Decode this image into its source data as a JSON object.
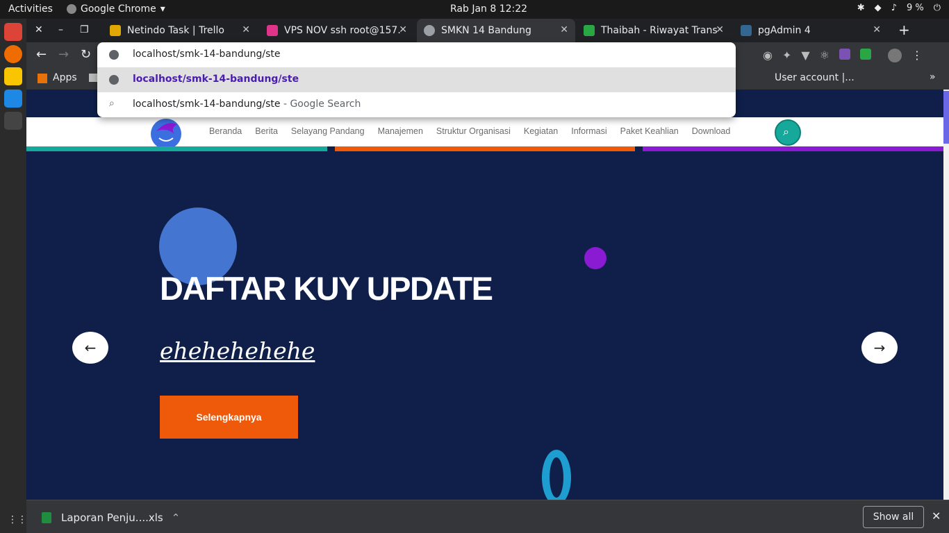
{
  "system": {
    "activities": "Activities",
    "app_name": "Google Chrome",
    "clock": "Rab Jan 8  12:22",
    "battery": "9 %"
  },
  "tabs": [
    {
      "title": "Netindo Task | Trello",
      "favicon_color": "#e0a800"
    },
    {
      "title": "VPS NOV ssh root@157.",
      "favicon_color": "#e0348a"
    },
    {
      "title": "SMKN 14 Bandung",
      "favicon_color": "#9aa0a6",
      "active": true
    },
    {
      "title": "Thaibah - Riwayat Trans",
      "favicon_color": "#2aa745"
    },
    {
      "title": "pgAdmin 4",
      "favicon_color": "#336791"
    }
  ],
  "omnibox": {
    "input_value": "localhost/smk-14-bandung/ste",
    "suggestions": [
      {
        "text": "localhost/smk-14-bandung/ste",
        "kind": "url"
      },
      {
        "text": "localhost/smk-14-bandung/ste",
        "suffix": " - Google Search",
        "kind": "search"
      }
    ]
  },
  "bookmarks": {
    "apps": "Apps",
    "user_account": "User account |..."
  },
  "site": {
    "nav": [
      "Beranda",
      "Berita",
      "Selayang Pandang",
      "Manajemen",
      "Struktur Organisasi",
      "Kegiatan",
      "Informasi",
      "Paket Keahlian",
      "Download"
    ],
    "stripe_colors": [
      "#16a89a",
      "#ef5a0a",
      "#8b1bd3"
    ],
    "hero": {
      "title": "DAFTAR KUY UPDATE",
      "subtitle": "ehehehehehe",
      "button": "Selengkapnya"
    }
  },
  "downloads": {
    "file": "Laporan Penju....xls",
    "show_all": "Show all"
  },
  "colors": {
    "hero_bg": "#0f1f4a",
    "accent_orange": "#ef5a0a",
    "accent_teal": "#16a89a",
    "accent_purple": "#8b1bd3"
  }
}
